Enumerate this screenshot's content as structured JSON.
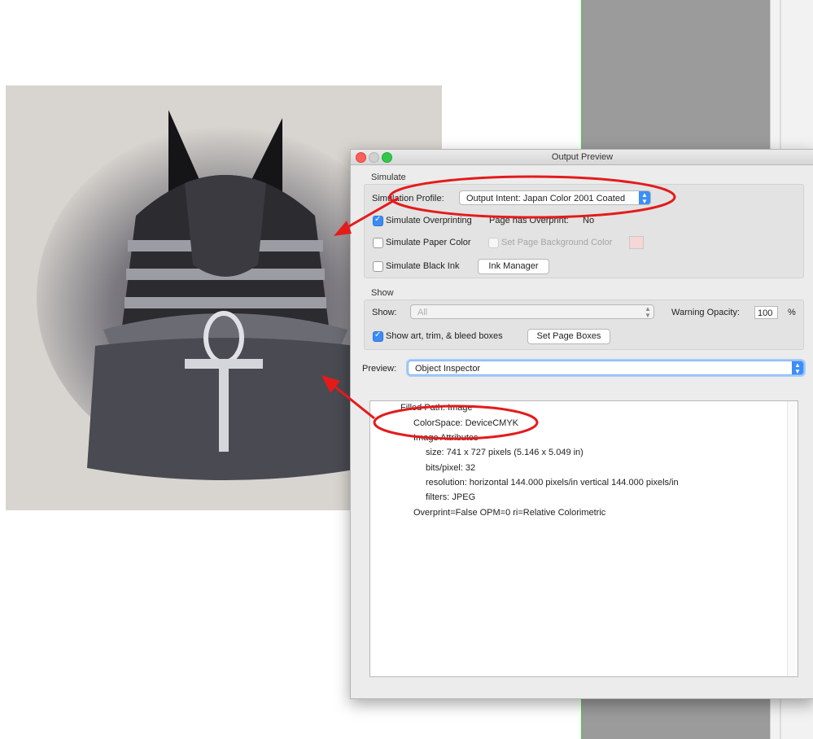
{
  "dialog": {
    "title": "Output Preview",
    "simulate": {
      "section_label": "Simulate",
      "profile_label": "Simulation Profile:",
      "profile_value": "Output Intent: Japan Color 2001 Coated",
      "simulate_overprinting": {
        "label": "Simulate Overprinting",
        "checked": true
      },
      "page_has_overprint_label": "Page has Overprint:",
      "page_has_overprint_value": "No",
      "simulate_paper_color": {
        "label": "Simulate Paper Color",
        "checked": false
      },
      "set_page_background_color": {
        "label": "Set Page Background Color",
        "checked": false,
        "enabled": false
      },
      "simulate_black_ink": {
        "label": "Simulate Black Ink",
        "checked": false
      },
      "ink_manager_button": "Ink Manager"
    },
    "show": {
      "section_label": "Show",
      "show_label": "Show:",
      "show_value": "All",
      "warning_opacity_label": "Warning Opacity:",
      "warning_opacity_value": "100",
      "warning_opacity_unit": "%",
      "show_boxes": {
        "label": "Show art, trim, & bleed boxes",
        "checked": true
      },
      "set_page_boxes_button": "Set Page Boxes"
    },
    "preview": {
      "label": "Preview:",
      "value": "Object Inspector"
    },
    "inspector_lines": [
      "Filled Path: Image",
      "ColorSpace: DeviceCMYK",
      "Image Attributes",
      "size: 741 x 727 pixels (5.146 x 5.049 in)",
      "bits/pixel: 32",
      "resolution: horizontal 144.000 pixels/in vertical 144.000 pixels/in",
      "filters: JPEG",
      "Overprint=False OPM=0 ri=Relative Colorimetric"
    ]
  },
  "colors": {
    "annotation_red": "#e41b1b",
    "accent_blue": "#3b8ff6",
    "window_bg": "#ececec"
  }
}
